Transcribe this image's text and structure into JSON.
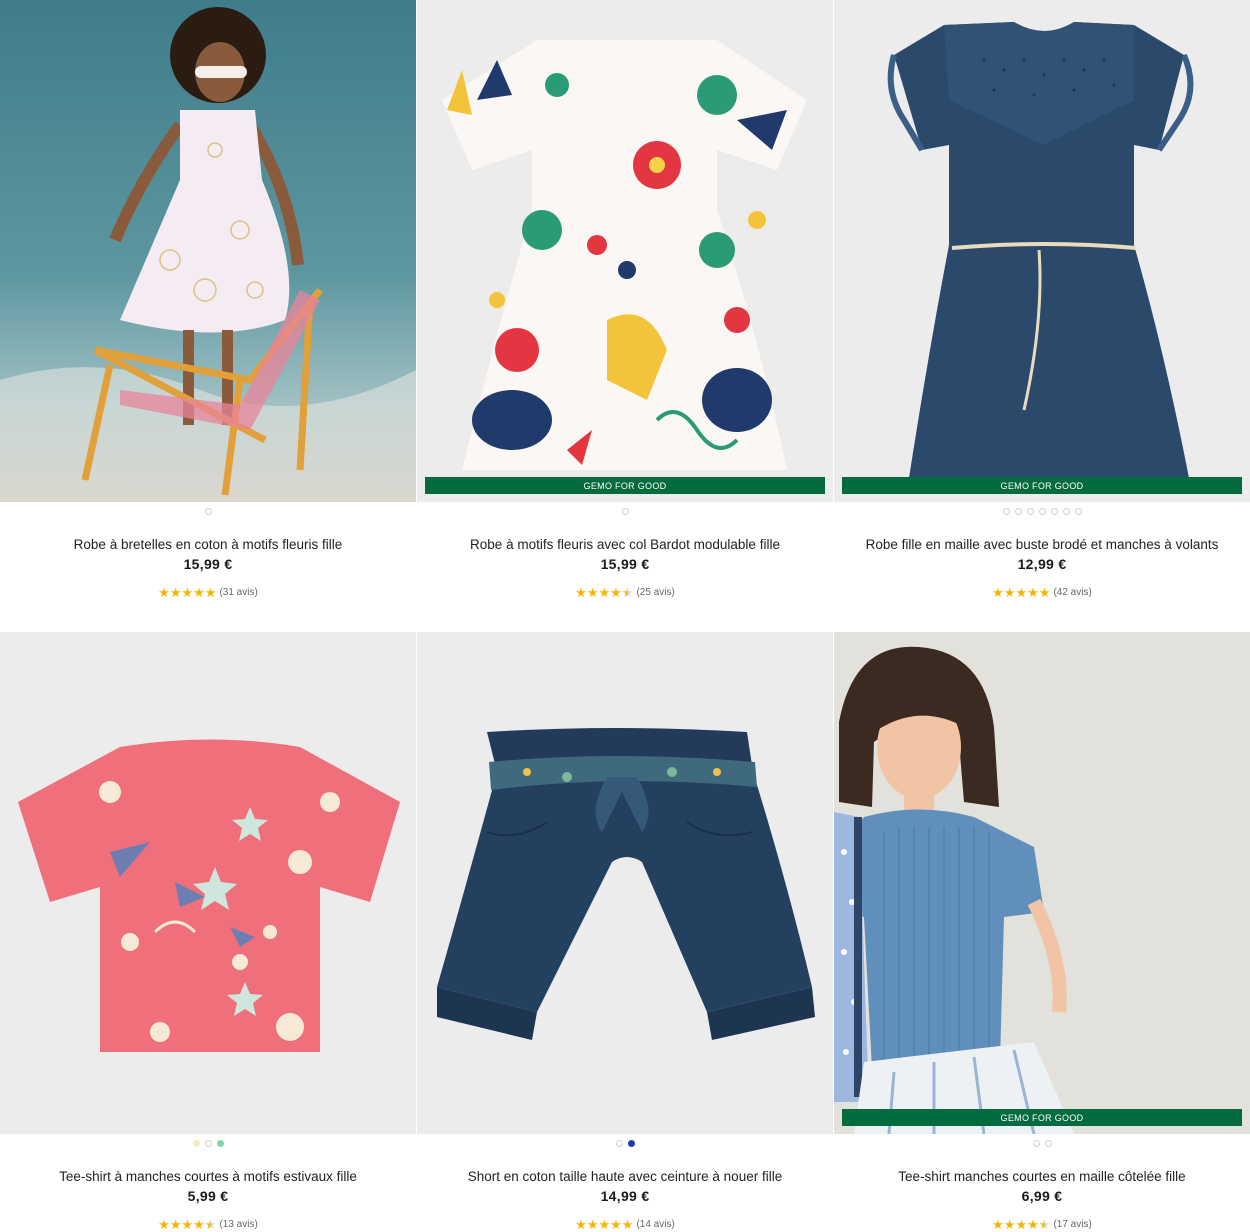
{
  "brand_color": "#046b3e",
  "star_color": "#f5b400",
  "products": [
    {
      "name": "Robe à bretelles en coton à motifs fleuris fille",
      "price": "15,99 €",
      "rating": 5,
      "reviews": "(31 avis)",
      "badge": "",
      "swatches": [
        "#ffffff"
      ]
    },
    {
      "name": "Robe à motifs fleuris avec col Bardot modulable fille",
      "price": "15,99 €",
      "rating": 4.5,
      "reviews": "(25 avis)",
      "badge": "GEMO FOR GOOD",
      "swatches": [
        "#ffffff"
      ]
    },
    {
      "name": "Robe fille en maille avec buste brodé et manches à volants",
      "price": "12,99 €",
      "rating": 5,
      "reviews": "(42 avis)",
      "badge": "GEMO FOR GOOD",
      "swatches": [
        "#ffffff",
        "#ffffff",
        "#ffffff",
        "#ffffff",
        "#ffffff",
        "#ffffff",
        "#ffffff"
      ]
    },
    {
      "name": "Tee-shirt à manches courtes à motifs estivaux fille",
      "price": "5,99 €",
      "rating": 4.5,
      "reviews": "(13 avis)",
      "badge": "",
      "swatches": [
        "#f3e9c2",
        "#ffffff",
        "#7ed3a8"
      ]
    },
    {
      "name": "Short en coton taille haute avec ceinture à nouer fille",
      "price": "14,99 €",
      "rating": 5,
      "reviews": "(14 avis)",
      "badge": "",
      "swatches": [
        "#ffffff",
        "#1e3cb0"
      ]
    },
    {
      "name": "Tee-shirt manches courtes en maille côtelée fille",
      "price": "6,99 €",
      "rating": 4.5,
      "reviews": "(17 avis)",
      "badge": "GEMO FOR GOOD",
      "swatches": [
        "#ffffff",
        "#ffffff"
      ]
    }
  ]
}
